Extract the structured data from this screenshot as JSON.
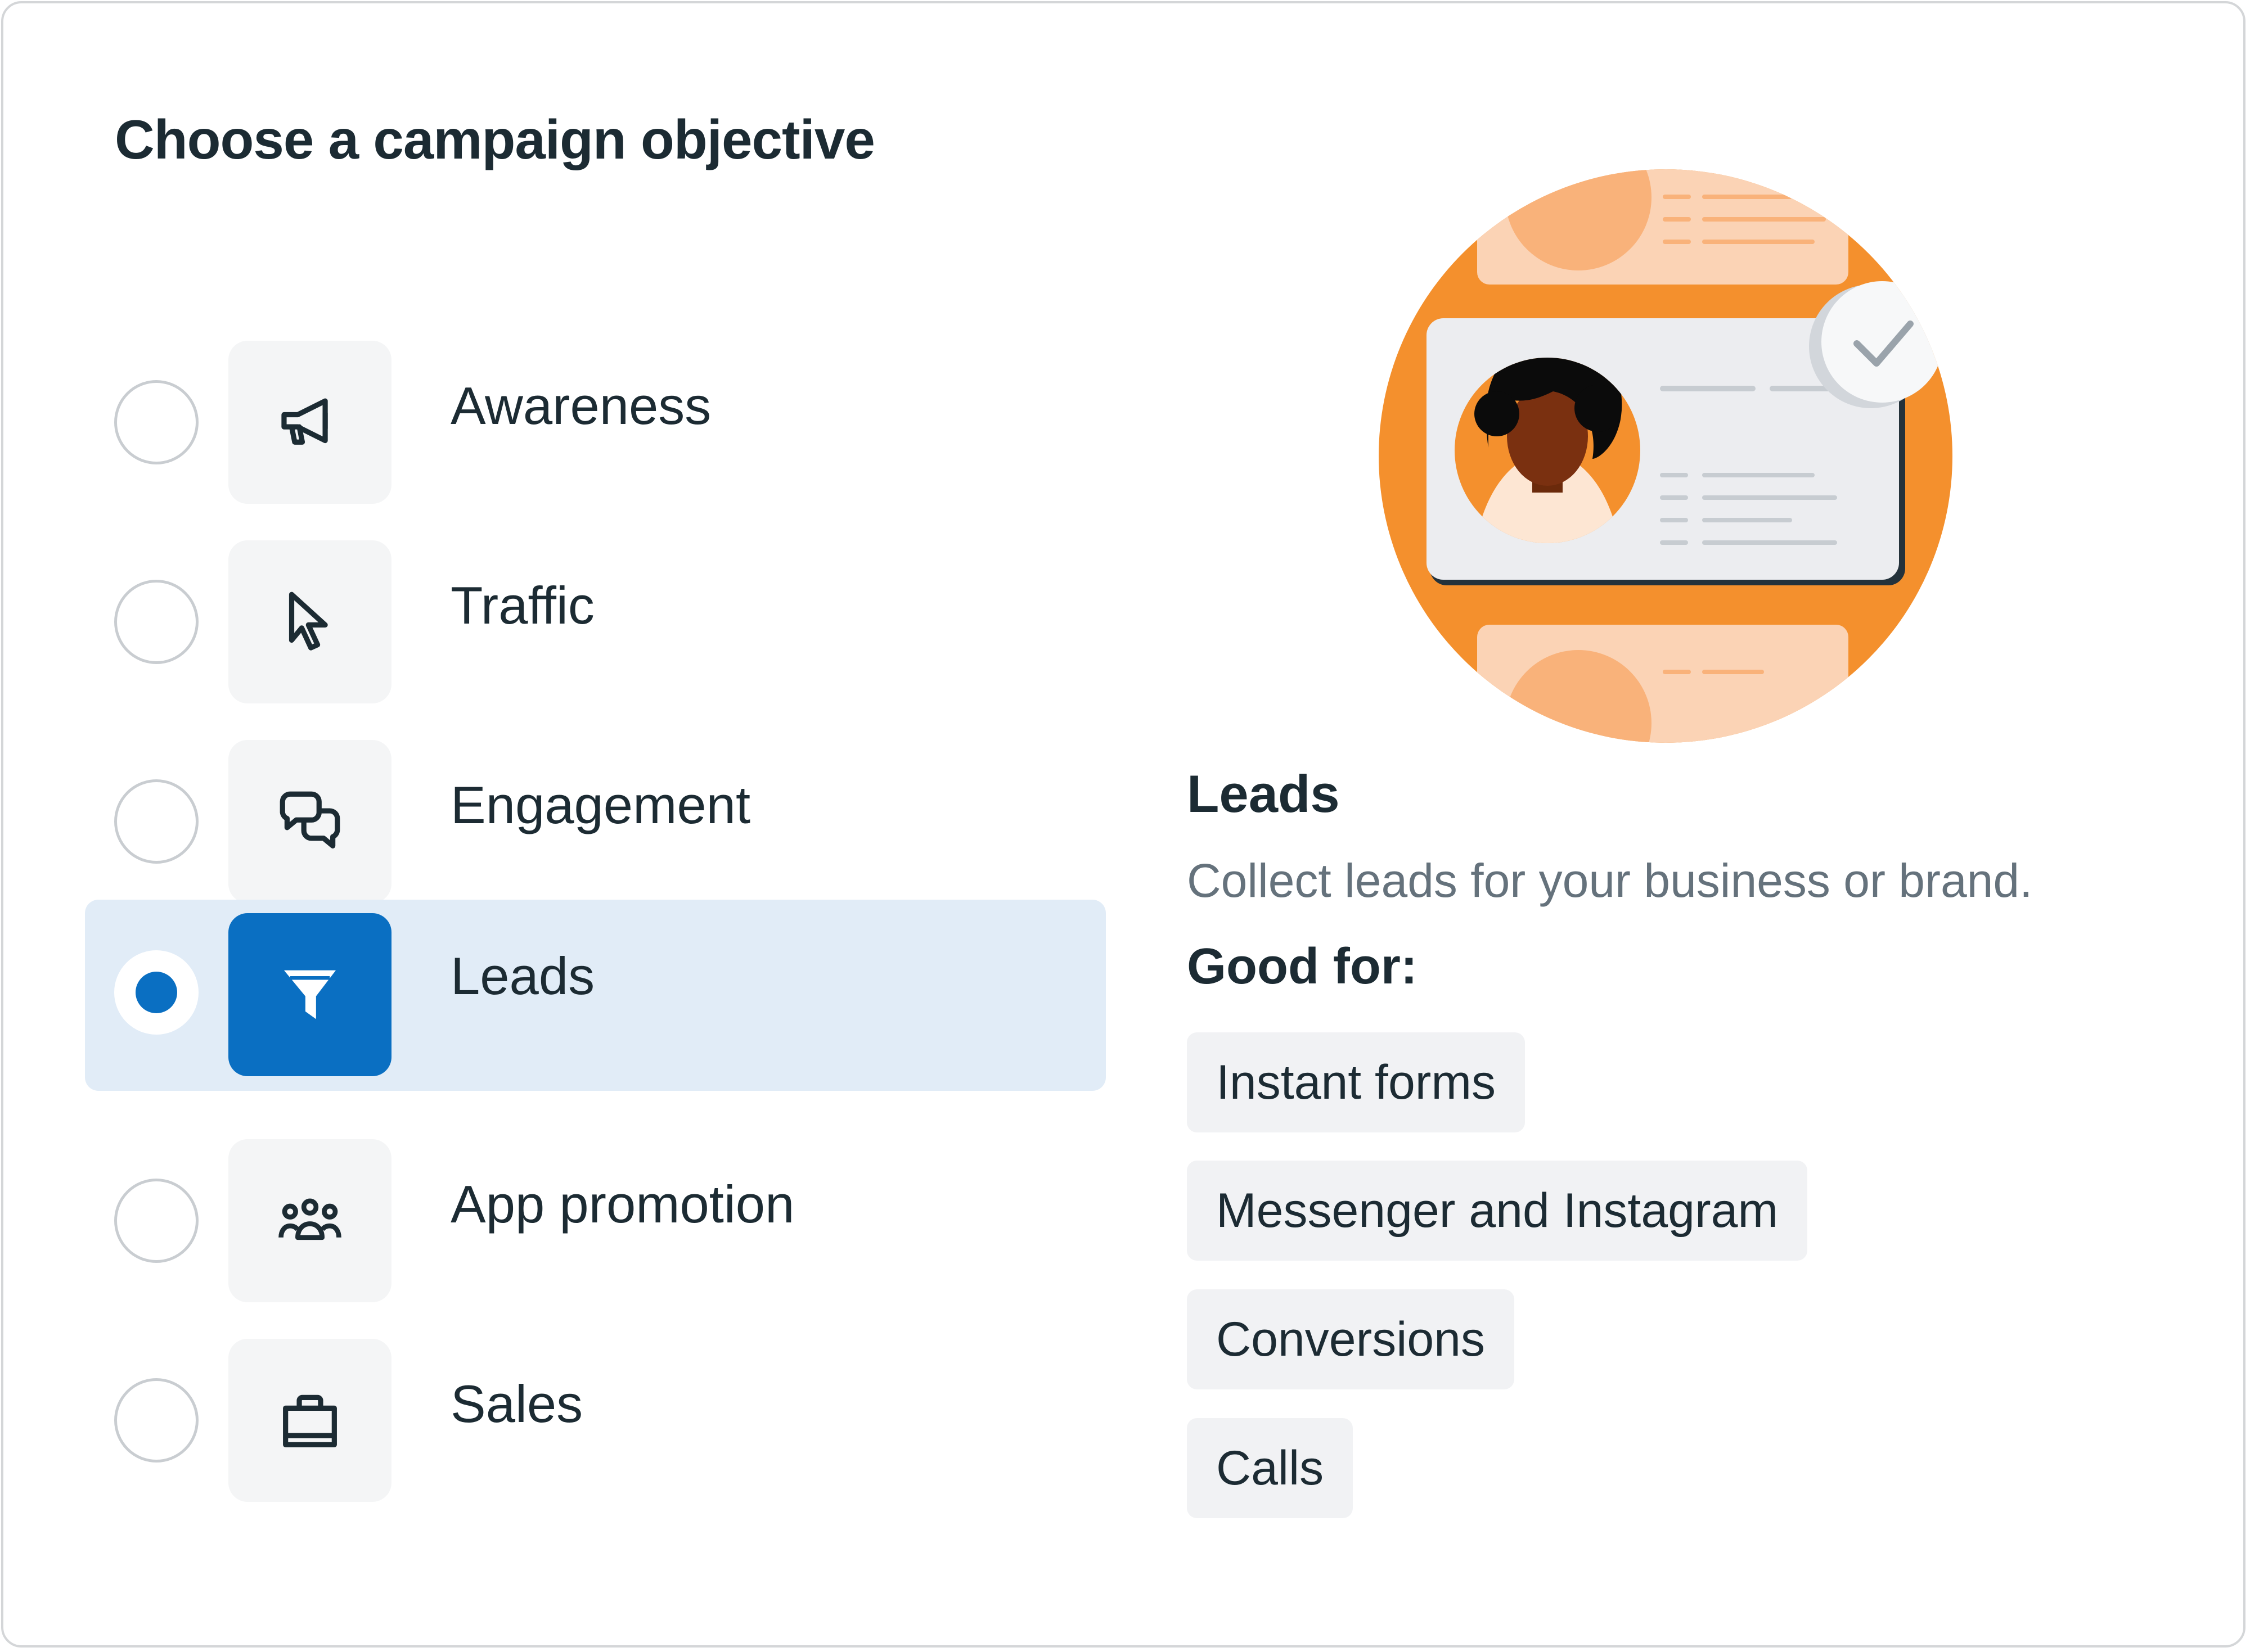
{
  "title": "Choose a campaign objective",
  "objectives": [
    {
      "label": "Awareness",
      "icon": "megaphone-icon",
      "selected": false
    },
    {
      "label": "Traffic",
      "icon": "cursor-icon",
      "selected": false
    },
    {
      "label": "Engagement",
      "icon": "chat-bubbles-icon",
      "selected": false
    },
    {
      "label": "Leads",
      "icon": "funnel-icon",
      "selected": true
    },
    {
      "label": "App promotion",
      "icon": "people-icon",
      "selected": false
    },
    {
      "label": "Sales",
      "icon": "shopping-bag-icon",
      "selected": false
    }
  ],
  "detail": {
    "title": "Leads",
    "description": "Collect leads for your business or brand.",
    "good_for_label": "Good for:",
    "tags": [
      "Instant forms",
      "Messenger and Instagram",
      "Conversions",
      "Calls"
    ]
  },
  "colors": {
    "accent": "#0a6fc2",
    "selected_row_bg": "#e1ecf7",
    "illustration_orange": "#f4902d",
    "text_primary": "#1c2b33",
    "text_secondary": "#65727c"
  }
}
